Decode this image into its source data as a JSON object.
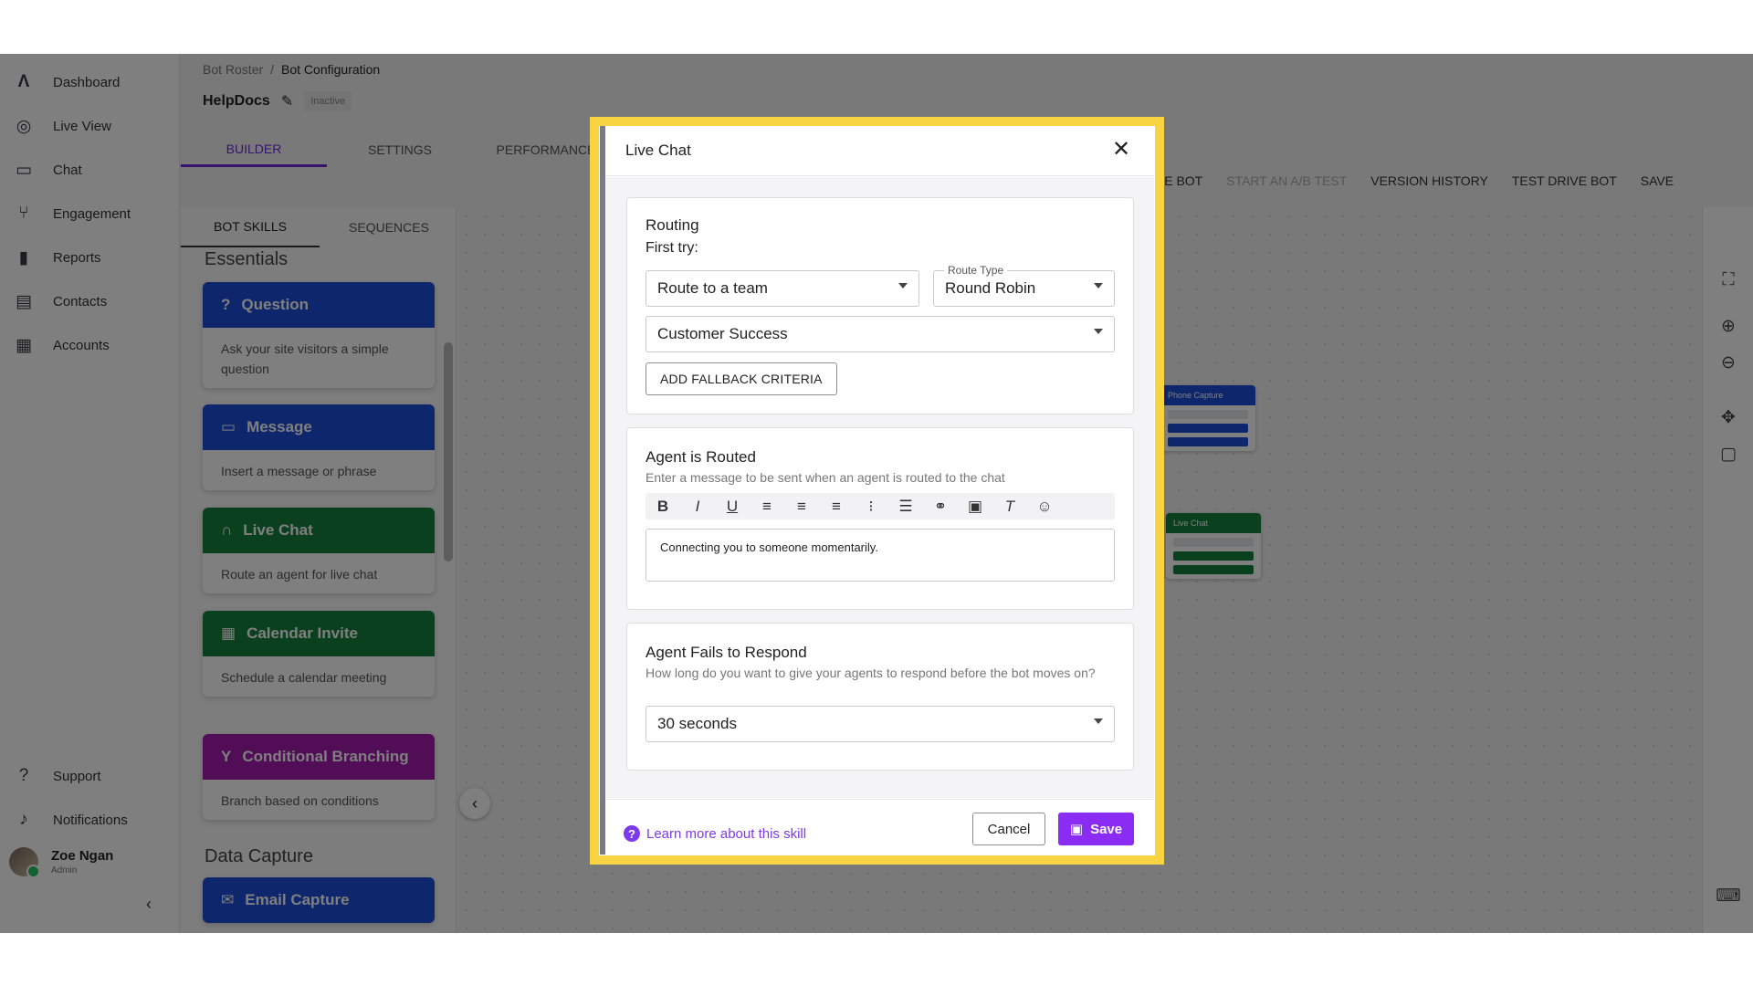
{
  "nav": {
    "items": [
      {
        "label": "Dashboard",
        "icon": "logo-icon"
      },
      {
        "label": "Live View",
        "icon": "live-view-icon"
      },
      {
        "label": "Chat",
        "icon": "chat-icon"
      },
      {
        "label": "Engagement",
        "icon": "engagement-icon"
      },
      {
        "label": "Reports",
        "icon": "bar-chart-icon"
      },
      {
        "label": "Contacts",
        "icon": "contacts-icon"
      },
      {
        "label": "Accounts",
        "icon": "building-icon"
      }
    ],
    "bottom": [
      {
        "label": "Support",
        "icon": "help-icon"
      },
      {
        "label": "Notifications",
        "icon": "bell-icon"
      }
    ],
    "user": {
      "name": "Zoe Ngan",
      "role": "Admin"
    }
  },
  "header": {
    "breadcrumb": [
      "Bot Roster",
      "/",
      "Bot Configuration"
    ],
    "bot_name": "HelpDocs",
    "status": "Inactive",
    "tabs": [
      "BUILDER",
      "SETTINGS",
      "PERFORMANCE"
    ],
    "toolbar": [
      "IVE BOT",
      "START AN A/B TEST",
      "VERSION HISTORY",
      "TEST DRIVE BOT",
      "SAVE"
    ]
  },
  "skills_panel": {
    "subtabs": [
      "BOT SKILLS",
      "SEQUENCES"
    ],
    "section_essentials": "Essentials",
    "section_data_capture": "Data Capture",
    "cards": [
      {
        "title": "Question",
        "desc": "Ask your site visitors a simple question"
      },
      {
        "title": "Message",
        "desc": "Insert a message or phrase"
      },
      {
        "title": "Live Chat",
        "desc": "Route an agent for live chat"
      },
      {
        "title": "Calendar Invite",
        "desc": "Schedule a calendar meeting"
      },
      {
        "title": "Conditional Branching",
        "desc": "Branch based on conditions"
      },
      {
        "title": "Email Capture",
        "desc": ""
      }
    ]
  },
  "canvas_nodes": {
    "node1_title": "Phone Capture",
    "node2_title": "Live Chat"
  },
  "modal": {
    "title": "Live Chat",
    "routing": {
      "title": "Routing",
      "first_try": "First try:",
      "route_target": "Route to a team",
      "route_type_label": "Route Type",
      "route_type": "Round Robin",
      "team": "Customer Success",
      "fallback_button": "ADD FALLBACK CRITERIA"
    },
    "agent_routed": {
      "title": "Agent is Routed",
      "subtitle": "Enter a message to be sent when an agent is routed to the chat",
      "message": "Connecting you to someone momentarily."
    },
    "agent_fails": {
      "title": "Agent Fails to Respond",
      "subtitle": "How long do you want to give your agents to respond before the bot moves on?",
      "timeout": "30 seconds"
    },
    "footer": {
      "learn_more": "Learn more about this skill",
      "cancel": "Cancel",
      "save": "Save"
    }
  },
  "colors": {
    "accent": "#8b2cf5",
    "highlight": "#f9d442",
    "question_card": "#1d4ed8",
    "livechat_card": "#15803d",
    "branching_card": "#a21caf"
  }
}
